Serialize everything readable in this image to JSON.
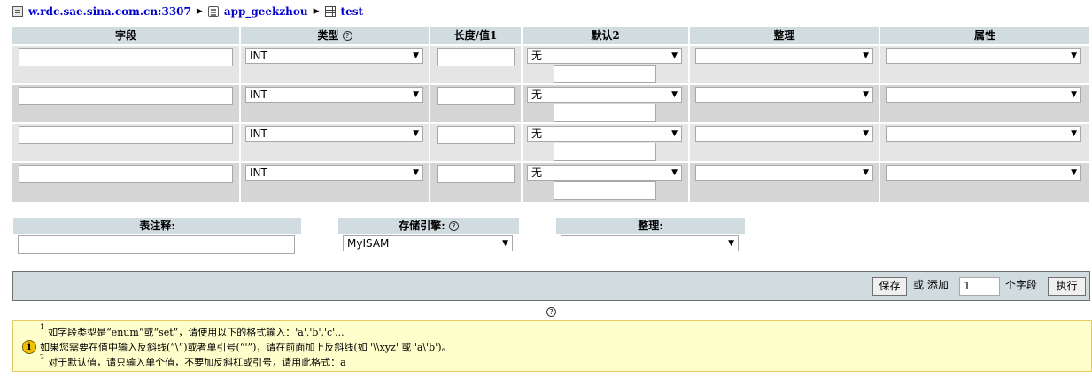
{
  "breadcrumb": {
    "server": "w.rdc.sae.sina.com.cn:3307",
    "database": "app_geekzhou",
    "table": "test"
  },
  "columns": {
    "field": "字段",
    "type": "类型",
    "length": "长度/值1",
    "default": "默认2",
    "collation": "整理",
    "attributes": "属性"
  },
  "rows": [
    {
      "name": "",
      "type": "INT",
      "length": "",
      "default": "无",
      "default_value": "",
      "collation": "",
      "attribute": ""
    },
    {
      "name": "",
      "type": "INT",
      "length": "",
      "default": "无",
      "default_value": "",
      "collation": "",
      "attribute": ""
    },
    {
      "name": "",
      "type": "INT",
      "length": "",
      "default": "无",
      "default_value": "",
      "collation": "",
      "attribute": ""
    },
    {
      "name": "",
      "type": "INT",
      "length": "",
      "default": "无",
      "default_value": "",
      "collation": "",
      "attribute": ""
    }
  ],
  "table_options": {
    "comment_label": "表注释:",
    "comment_value": "",
    "engine_label": "存储引擎:",
    "engine_value": "MyISAM",
    "collation_label": "整理:",
    "collation_value": ""
  },
  "footer": {
    "save": "保存",
    "or_add": "或 添加",
    "add_count": "1",
    "fields_suffix": "个字段",
    "go": "执行"
  },
  "help_symbol": "?",
  "info_symbol": "i",
  "notes": {
    "n1_marker": "1",
    "n1_line1": "如字段类型是“enum”或“set”，请使用以下的格式输入：'a','b','c'...",
    "n1_line2": "如果您需要在值中输入反斜线(“\\”)或者单引号(“'”)，请在前面加上反斜线(如 '\\\\xyz' 或 'a\\'b')。",
    "n2_marker": "2",
    "n2_line": "对于默认值，请只输入单个值，不要加反斜杠或引号，请用此格式：a"
  },
  "colors": {
    "header_bg": "#d0dce0",
    "row_bg": "#e5e5e5",
    "link": "#0000cc",
    "note_bg": "#ffffcc"
  }
}
